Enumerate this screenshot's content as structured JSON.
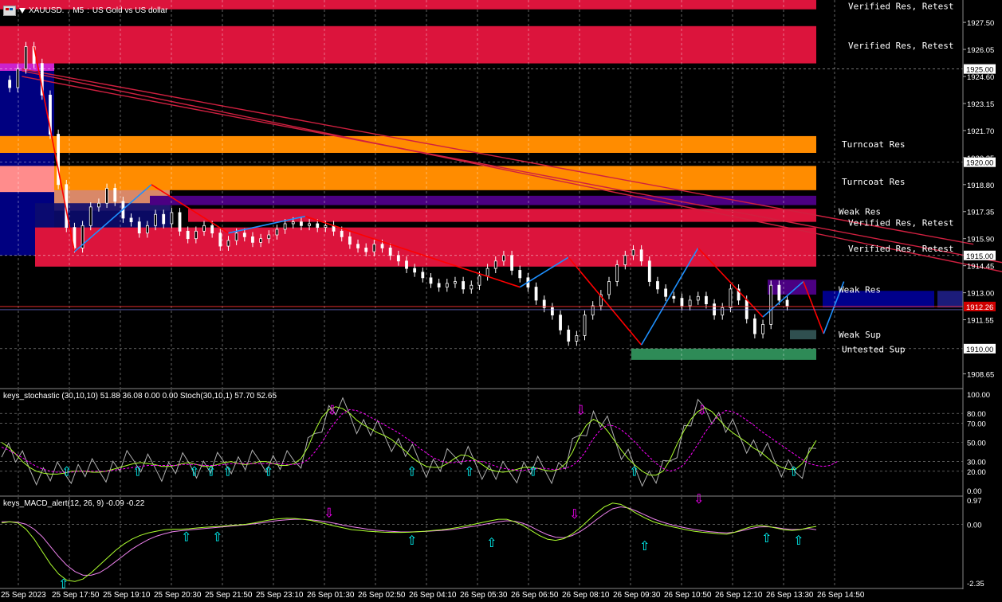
{
  "header": {
    "symbol": "XAUUSD.",
    "timeframe": "M5",
    "description": "US Gold vs US dollar"
  },
  "colors": {
    "verified_res": "#dc143c",
    "turncoat_res": "#ff8c00",
    "weak_res": "#4b0082",
    "weak_sup": "#2f4f4f",
    "untested_sup": "#2e8b57",
    "zigzag_down": "#ff0000",
    "zigzag_up": "#1e90ff",
    "stoch_main": "#adff2f",
    "stoch_signal": "#ff00ff",
    "macd_line": "#adff2f",
    "macd_signal": "#ee82ee",
    "arrow_up": "#00ffff",
    "arrow_down": "#ff00ff"
  },
  "zone_labels": [
    "Verified Res, Retest",
    "Verified Res, Retest",
    "Turncoat Res",
    "Turncoat Res",
    "Weak Res",
    "Verified Res, Retest",
    "Verified Res, Retest",
    "Weak Res",
    "Weak Sup",
    "Untested Sup"
  ],
  "stoch_label": "keys_stochastic (30,10,10) 51.88 36.08 0.00 0.00 Stoch(30,10,1) 57.70 52.65",
  "macd_label": "keys_MACD_alert(12, 26, 9) -0.09 -0.22",
  "chart_data": [
    {
      "type": "candlestick",
      "title": "XAUUSD., M5: US Gold vs US dollar",
      "x_ticks": [
        "25 Sep 2023",
        "25 Sep 17:50",
        "25 Sep 19:10",
        "25 Sep 20:30",
        "25 Sep 21:50",
        "25 Sep 23:10",
        "26 Sep 01:30",
        "26 Sep 02:50",
        "26 Sep 04:10",
        "26 Sep 05:30",
        "26 Sep 06:50",
        "26 Sep 08:10",
        "26 Sep 09:30",
        "26 Sep 10:50",
        "26 Sep 12:10",
        "26 Sep 13:30",
        "26 Sep 14:50"
      ],
      "y_ticks": [
        "1927.50",
        "1926.05",
        "1924.60",
        "1923.15",
        "1921.70",
        "1920.25",
        "1918.80",
        "1917.35",
        "1915.90",
        "1914.45",
        "1913.00",
        "1911.55",
        "1908.65"
      ],
      "ylim": [
        1907.9,
        1928.7
      ],
      "price_levels": [
        "1925.00",
        "1920.00",
        "1915.00",
        "1910.00"
      ],
      "current_price": "1912.26",
      "close_path": [
        [
          0,
          1924.4
        ],
        [
          2,
          1924.0
        ],
        [
          4,
          1925.0
        ],
        [
          6,
          1926.2
        ],
        [
          8,
          1925.3
        ],
        [
          10,
          1923.6
        ],
        [
          12,
          1921.5
        ],
        [
          14,
          1918.8
        ],
        [
          16,
          1916.5
        ],
        [
          18,
          1915.4
        ],
        [
          20,
          1916.6
        ],
        [
          22,
          1917.6
        ],
        [
          24,
          1917.8
        ],
        [
          26,
          1918.6
        ],
        [
          28,
          1917.9
        ],
        [
          30,
          1917.0
        ],
        [
          32,
          1916.8
        ],
        [
          34,
          1916.2
        ],
        [
          36,
          1916.6
        ],
        [
          38,
          1917.2
        ],
        [
          40,
          1916.7
        ],
        [
          42,
          1917.3
        ],
        [
          44,
          1916.3
        ],
        [
          46,
          1915.9
        ],
        [
          48,
          1916.3
        ],
        [
          50,
          1916.6
        ],
        [
          52,
          1916.2
        ],
        [
          54,
          1915.5
        ],
        [
          56,
          1915.8
        ],
        [
          58,
          1916.2
        ],
        [
          60,
          1916.0
        ],
        [
          62,
          1915.7
        ],
        [
          64,
          1915.9
        ],
        [
          66,
          1916.1
        ],
        [
          68,
          1916.4
        ],
        [
          70,
          1916.7
        ],
        [
          72,
          1916.8
        ],
        [
          74,
          1916.6
        ],
        [
          76,
          1916.7
        ],
        [
          78,
          1916.5
        ],
        [
          80,
          1916.6
        ],
        [
          82,
          1916.3
        ],
        [
          84,
          1916.0
        ],
        [
          86,
          1915.6
        ],
        [
          88,
          1915.4
        ],
        [
          90,
          1915.2
        ],
        [
          92,
          1915.6
        ],
        [
          94,
          1915.4
        ],
        [
          96,
          1915.0
        ],
        [
          98,
          1914.7
        ],
        [
          100,
          1914.3
        ],
        [
          102,
          1914.1
        ],
        [
          104,
          1913.8
        ],
        [
          106,
          1913.5
        ],
        [
          108,
          1913.3
        ],
        [
          110,
          1913.5
        ],
        [
          112,
          1913.6
        ],
        [
          114,
          1913.2
        ],
        [
          116,
          1913.4
        ],
        [
          118,
          1913.9
        ],
        [
          120,
          1914.3
        ],
        [
          122,
          1914.7
        ],
        [
          124,
          1915.0
        ],
        [
          126,
          1914.2
        ],
        [
          128,
          1913.8
        ],
        [
          130,
          1913.3
        ],
        [
          132,
          1912.6
        ],
        [
          134,
          1912.2
        ],
        [
          136,
          1911.8
        ],
        [
          138,
          1911.0
        ],
        [
          140,
          1910.4
        ],
        [
          142,
          1910.7
        ],
        [
          144,
          1911.8
        ],
        [
          146,
          1912.3
        ],
        [
          148,
          1912.9
        ],
        [
          150,
          1913.6
        ],
        [
          152,
          1914.5
        ],
        [
          154,
          1915.0
        ],
        [
          156,
          1915.3
        ],
        [
          158,
          1914.7
        ],
        [
          160,
          1913.6
        ],
        [
          162,
          1913.2
        ],
        [
          164,
          1912.8
        ],
        [
          166,
          1912.7
        ],
        [
          168,
          1912.3
        ],
        [
          170,
          1912.6
        ],
        [
          172,
          1912.8
        ],
        [
          174,
          1912.4
        ],
        [
          176,
          1911.8
        ],
        [
          178,
          1912.2
        ],
        [
          180,
          1913.2
        ],
        [
          182,
          1912.6
        ],
        [
          184,
          1911.6
        ],
        [
          186,
          1910.8
        ],
        [
          188,
          1911.3
        ],
        [
          190,
          1913.4
        ],
        [
          192,
          1912.6
        ],
        [
          194,
          1912.3
        ]
      ],
      "zigzag": [
        [
          8,
          1926.2
        ],
        [
          18,
          1915.2
        ],
        [
          37,
          1918.8
        ],
        [
          56,
          1916.2
        ],
        [
          75,
          1917.1
        ],
        [
          128,
          1913.3
        ],
        [
          140,
          1914.9
        ],
        [
          158,
          1910.2
        ],
        [
          172,
          1915.4
        ],
        [
          188,
          1911.7
        ],
        [
          198,
          1913.6
        ],
        [
          203,
          1910.8
        ],
        [
          208,
          1913.6
        ]
      ],
      "moving_averages": [
        {
          "from": [
            5,
            1924.9
          ],
          "to": [
            250,
            1914.0
          ]
        },
        {
          "from": [
            5,
            1925.0
          ],
          "to": [
            240,
            1915.6
          ]
        },
        {
          "from": [
            5,
            1924.6
          ],
          "to": [
            250,
            1914.5
          ]
        }
      ]
    },
    {
      "type": "line",
      "title": "keys_stochastic (30,10,10) 51.88 36.08 0.00 0.00 Stoch(30,10,1) 57.70 52.65",
      "y_ticks": [
        "100.00",
        "80.00",
        "70.00",
        "50.00",
        "30.00",
        "20.00",
        "0.00"
      ],
      "ylim": [
        -5,
        105
      ],
      "series": [
        {
          "values": [
            50,
            45,
            38,
            30,
            24,
            20,
            18,
            17,
            17,
            18,
            20,
            20,
            20,
            19,
            19,
            20,
            22,
            24,
            26,
            28,
            29,
            28,
            27,
            25,
            25,
            26,
            28,
            29,
            27,
            25,
            25,
            27,
            29,
            30,
            28,
            27,
            28,
            30,
            30,
            28,
            26,
            26,
            28,
            33,
            45,
            62,
            76,
            84,
            87,
            85,
            80,
            73,
            68,
            64,
            60,
            57,
            53,
            47,
            41,
            34,
            29,
            25,
            24,
            24,
            28,
            33,
            37,
            36,
            32,
            27,
            22,
            20,
            19,
            20,
            22,
            24,
            24,
            23,
            21,
            20,
            22,
            28,
            40,
            56,
            68,
            74,
            70,
            62,
            52,
            42,
            33,
            26,
            20,
            16,
            16,
            20,
            32,
            48,
            62,
            74,
            82,
            86,
            82,
            74,
            66,
            60,
            55,
            50,
            44,
            40,
            34,
            28,
            24,
            22,
            22,
            28,
            40,
            52
          ]
        },
        {
          "values": [
            45,
            42,
            38,
            34,
            29,
            25,
            22,
            20,
            19,
            19,
            19,
            20,
            20,
            20,
            20,
            20,
            21,
            22,
            23,
            24,
            25,
            26,
            26,
            26,
            26,
            26,
            27,
            27,
            27,
            26,
            26,
            26,
            27,
            28,
            28,
            28,
            28,
            28,
            28,
            28,
            28,
            27,
            27,
            28,
            32,
            40,
            50,
            62,
            72,
            80,
            84,
            83,
            80,
            76,
            72,
            68,
            64,
            60,
            55,
            50,
            44,
            39,
            34,
            31,
            29,
            29,
            30,
            31,
            31,
            30,
            28,
            25,
            23,
            22,
            21,
            21,
            22,
            23,
            23,
            22,
            22,
            23,
            26,
            32,
            42,
            54,
            63,
            68,
            67,
            63,
            57,
            50,
            42,
            35,
            28,
            23,
            20,
            22,
            27,
            37,
            48,
            60,
            70,
            78,
            83,
            82,
            78,
            73,
            68,
            62,
            57,
            52,
            47,
            42,
            37,
            32,
            28,
            26,
            25,
            26,
            30
          ]
        }
      ]
    },
    {
      "type": "line",
      "title": "keys_MACD_alert(12, 26, 9) -0.09 -0.22",
      "y_ticks": [
        "0.97",
        "0.00",
        "-2.35"
      ],
      "ylim": [
        -2.55,
        1.1
      ],
      "series": [
        {
          "values": [
            0.05,
            0.1,
            0.05,
            -0.2,
            -0.6,
            -1.1,
            -1.6,
            -2.0,
            -2.25,
            -2.3,
            -2.2,
            -1.95,
            -1.65,
            -1.35,
            -1.05,
            -0.8,
            -0.6,
            -0.45,
            -0.35,
            -0.28,
            -0.22,
            -0.2,
            -0.2,
            -0.18,
            -0.15,
            -0.12,
            -0.1,
            -0.08,
            -0.05,
            -0.03,
            0.0,
            0.05,
            0.12,
            0.18,
            0.22,
            0.24,
            0.23,
            0.2,
            0.15,
            0.08,
            0.0,
            -0.08,
            -0.15,
            -0.22,
            -0.25,
            -0.28,
            -0.3,
            -0.32,
            -0.33,
            -0.33,
            -0.32,
            -0.3,
            -0.28,
            -0.25,
            -0.22,
            -0.18,
            -0.13,
            -0.07,
            0.0,
            0.07,
            0.14,
            0.2,
            0.2,
            0.1,
            -0.05,
            -0.25,
            -0.45,
            -0.6,
            -0.65,
            -0.58,
            -0.4,
            -0.15,
            0.15,
            0.45,
            0.7,
            0.85,
            0.8,
            0.62,
            0.42,
            0.25,
            0.1,
            0.0,
            -0.08,
            -0.15,
            -0.22,
            -0.28,
            -0.32,
            -0.35,
            -0.38,
            -0.4,
            -0.32,
            -0.2,
            -0.1,
            -0.05,
            -0.08,
            -0.15,
            -0.22,
            -0.25,
            -0.22,
            -0.14,
            -0.09
          ]
        },
        {
          "values": [
            0.1,
            0.1,
            0.08,
            0.0,
            -0.2,
            -0.5,
            -0.9,
            -1.3,
            -1.65,
            -1.9,
            -2.05,
            -2.05,
            -1.95,
            -1.75,
            -1.5,
            -1.25,
            -1.0,
            -0.8,
            -0.62,
            -0.48,
            -0.38,
            -0.3,
            -0.26,
            -0.23,
            -0.2,
            -0.17,
            -0.14,
            -0.11,
            -0.08,
            -0.05,
            -0.02,
            0.02,
            0.06,
            0.11,
            0.15,
            0.18,
            0.2,
            0.2,
            0.18,
            0.14,
            0.09,
            0.03,
            -0.04,
            -0.1,
            -0.15,
            -0.2,
            -0.24,
            -0.27,
            -0.29,
            -0.31,
            -0.31,
            -0.3,
            -0.29,
            -0.27,
            -0.25,
            -0.22,
            -0.18,
            -0.13,
            -0.08,
            -0.02,
            0.04,
            0.1,
            0.14,
            0.12,
            0.04,
            -0.1,
            -0.27,
            -0.42,
            -0.52,
            -0.54,
            -0.46,
            -0.3,
            -0.08,
            0.18,
            0.42,
            0.62,
            0.7,
            0.65,
            0.52,
            0.37,
            0.22,
            0.1,
            0.0,
            -0.08,
            -0.15,
            -0.21,
            -0.26,
            -0.3,
            -0.33,
            -0.35,
            -0.32,
            -0.25,
            -0.17,
            -0.11,
            -0.1,
            -0.13,
            -0.18,
            -0.21,
            -0.21,
            -0.17,
            -0.22
          ]
        }
      ]
    }
  ]
}
